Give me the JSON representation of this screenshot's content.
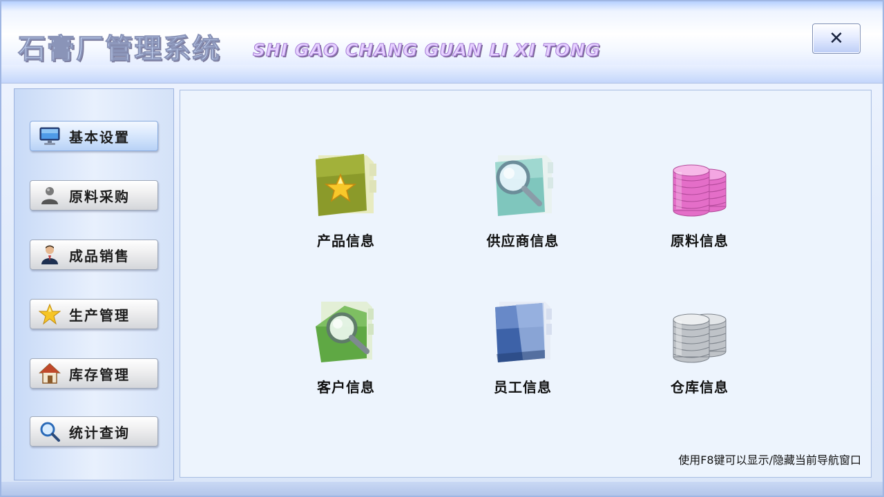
{
  "window": {
    "title_cn": "石膏厂管理系统",
    "title_en": "SHI GAO CHANG GUAN LI XI TONG",
    "close_label": "✕"
  },
  "sidebar": {
    "items": [
      {
        "label": "基本设置",
        "icon": "monitor-icon",
        "active": true
      },
      {
        "label": "原料采购",
        "icon": "user-icon",
        "active": false
      },
      {
        "label": "成品销售",
        "icon": "salesman-icon",
        "active": false
      },
      {
        "label": "生产管理",
        "icon": "star-icon",
        "active": false
      },
      {
        "label": "库存管理",
        "icon": "house-icon",
        "active": false
      },
      {
        "label": "统计查询",
        "icon": "search-icon",
        "active": false
      }
    ]
  },
  "main": {
    "tiles": [
      {
        "label": "产品信息",
        "icon": "star-folder-icon"
      },
      {
        "label": "供应商信息",
        "icon": "magnifier-folder-icon"
      },
      {
        "label": "原料信息",
        "icon": "pink-coins-icon"
      },
      {
        "label": "客户信息",
        "icon": "green-magnifier-folder-icon"
      },
      {
        "label": "员工信息",
        "icon": "blue-folder-icon"
      },
      {
        "label": "仓库信息",
        "icon": "silver-coins-icon"
      }
    ],
    "hint": "使用F8键可以显示/隐藏当前导航窗口"
  },
  "colors": {
    "panel_bg": "#edf4fd",
    "sidebar_active": "#b8d2f6",
    "title_purple": "#a47ad6"
  }
}
